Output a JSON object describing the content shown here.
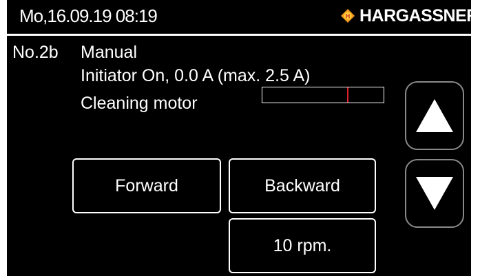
{
  "header": {
    "datetime": "Mo,16.09.19 08:19",
    "brand": "HARGASSNER",
    "logo_icon": "hargassner-diamond-logo-icon",
    "brand_colors": {
      "logo_fill": "#f39a1e",
      "logo_letter": "#d3242b"
    }
  },
  "component": {
    "number": "No.2b",
    "mode": "Manual",
    "initiator_status": "Initiator On, 0.0 A (max. 2.5 A)",
    "motor_label": "Cleaning motor"
  },
  "meter": {
    "current_a": 0.0,
    "max_a": 2.5,
    "marker_fraction": 0.7,
    "marker_color": "#e0202a"
  },
  "buttons": {
    "forward": "Forward",
    "backward": "Backward",
    "speed": "10 rpm."
  },
  "navigation": {
    "up_icon": "arrow-up-icon",
    "down_icon": "arrow-down-icon"
  }
}
